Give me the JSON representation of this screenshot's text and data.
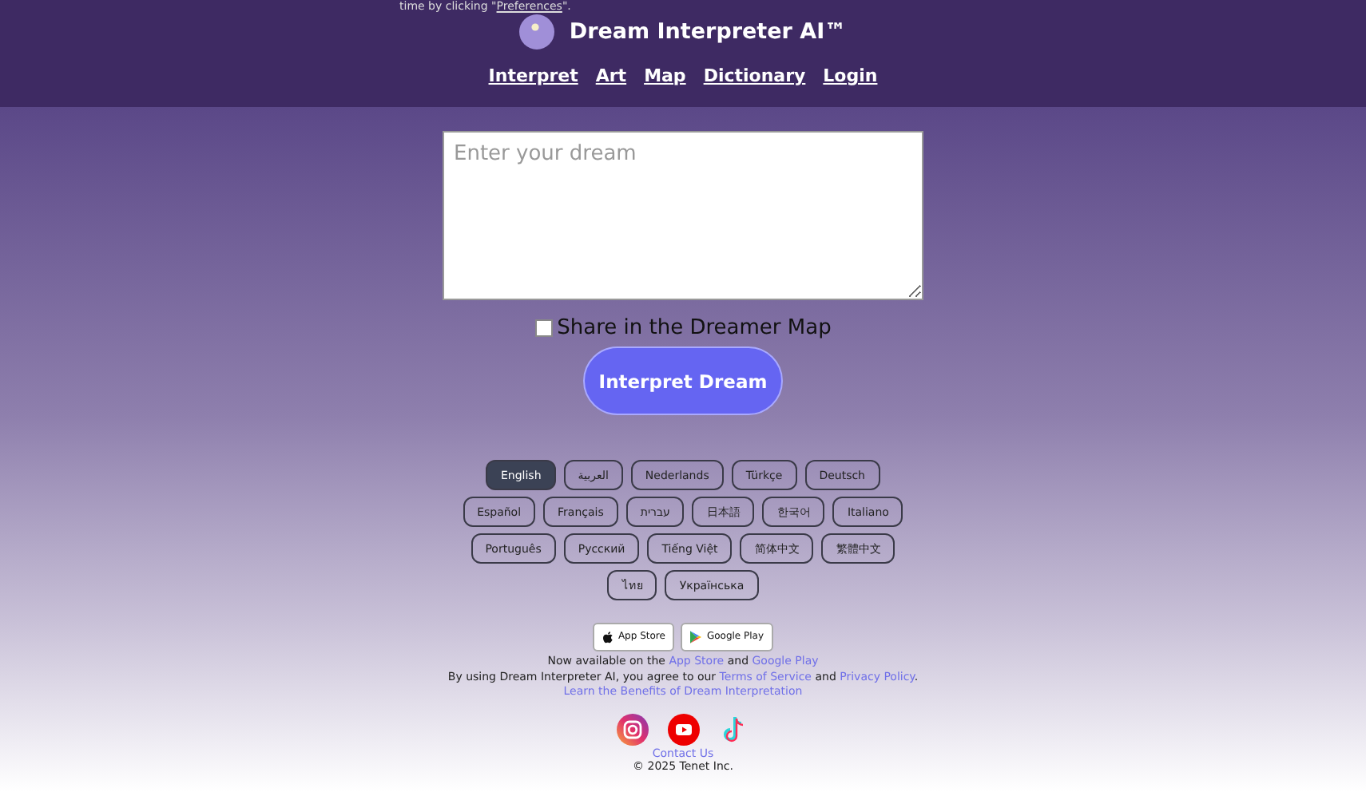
{
  "notice": {
    "text": "time by clicking \"",
    "link": "Preferences",
    "end": "\"."
  },
  "brand": {
    "title": "Dream Interpreter AI™"
  },
  "nav": [
    "Interpret",
    "Art",
    "Map",
    "Dictionary",
    "Login"
  ],
  "dream_input": {
    "placeholder": "Enter your dream"
  },
  "share": {
    "label": "Share in the Dreamer Map",
    "checked": false
  },
  "submit": "Interpret Dream",
  "language_rows": [
    [
      {
        "label": "English",
        "selected": true
      },
      {
        "label": "العربية",
        "selected": false
      },
      {
        "label": "Nederlands",
        "selected": false
      },
      {
        "label": "Türkçe",
        "selected": false
      },
      {
        "label": "Deutsch",
        "selected": false
      }
    ],
    [
      {
        "label": "Español",
        "selected": false
      },
      {
        "label": "Français",
        "selected": false
      },
      {
        "label": "עברית",
        "selected": false
      },
      {
        "label": "日本語",
        "selected": false
      },
      {
        "label": "한국어",
        "selected": false
      },
      {
        "label": "Italiano",
        "selected": false
      }
    ],
    [
      {
        "label": "Português",
        "selected": false
      },
      {
        "label": "Русский",
        "selected": false
      },
      {
        "label": "Tiếng Việt",
        "selected": false
      },
      {
        "label": "简体中文",
        "selected": false
      },
      {
        "label": "繁體中文",
        "selected": false
      }
    ],
    [
      {
        "label": "ไทย",
        "selected": false
      },
      {
        "label": "Українська",
        "selected": false
      }
    ]
  ],
  "stores": [
    {
      "kind": "apple",
      "label": "App Store"
    },
    {
      "kind": "google",
      "label": "Google Play"
    }
  ],
  "availability": {
    "text": "Now available on the",
    "link1": "App Store",
    "mid": "and",
    "link2": "Google Play"
  },
  "terms": {
    "text": "By using Dream Interpreter AI, you agree to our",
    "link1": "Terms of Service",
    "mid": "and",
    "link2": "Privacy Policy",
    "end": "."
  },
  "benefits_link": "Learn the Benefits of Dream Interpretation",
  "social": [
    {
      "kind": "instagram"
    },
    {
      "kind": "youtube"
    },
    {
      "kind": "tiktok"
    }
  ],
  "contact_link": "Contact Us",
  "copyright": "© 2025 Tenet Inc."
}
